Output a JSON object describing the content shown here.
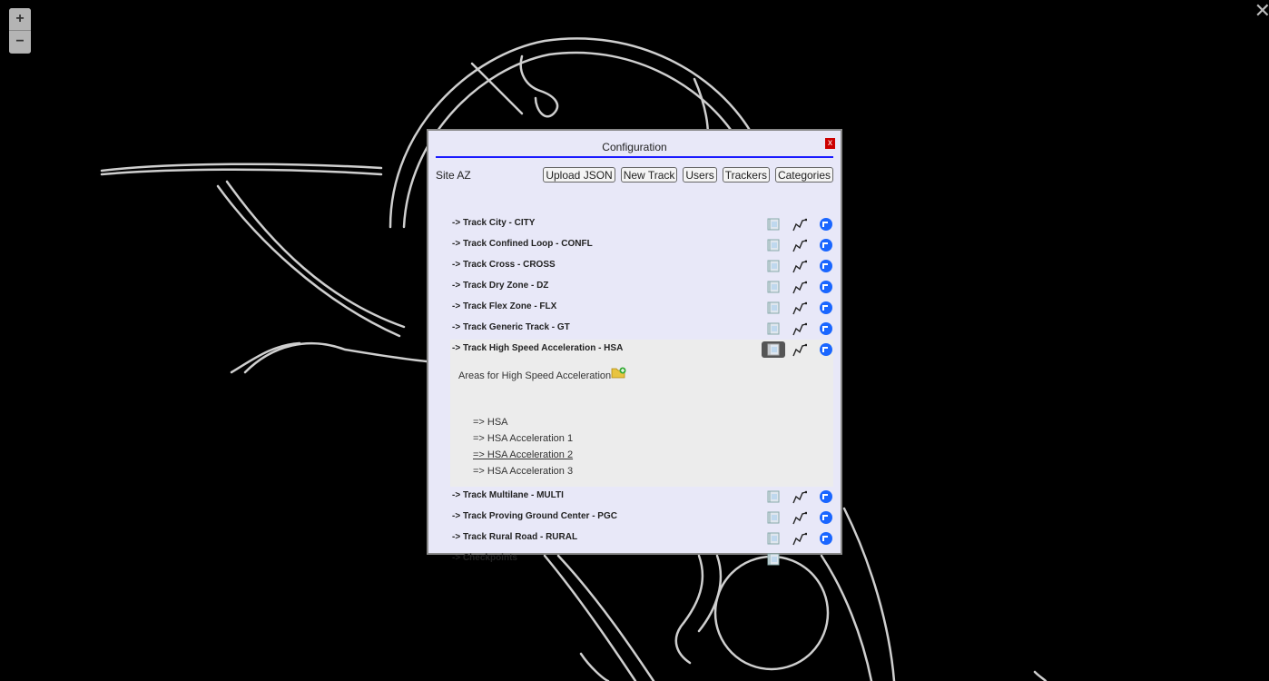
{
  "map": {
    "zoom_in": "+",
    "zoom_out": "−",
    "close": "✕"
  },
  "dialog": {
    "title": "Configuration",
    "close_label": "x",
    "site": "Site AZ",
    "buttons": [
      "Upload JSON",
      "New Track",
      "Users",
      "Trackers",
      "Categories"
    ]
  },
  "tracks": [
    {
      "label": "-> Track City - CITY"
    },
    {
      "label": "-> Track Confined Loop - CONFL"
    },
    {
      "label": "-> Track Cross - CROSS"
    },
    {
      "label": "-> Track Dry Zone - DZ"
    },
    {
      "label": "-> Track Flex Zone - FLX"
    },
    {
      "label": "-> Track Generic Track - GT"
    },
    {
      "label": "-> Track High Speed Acceleration - HSA"
    },
    {
      "label": "-> Track Multilane - MULTI"
    },
    {
      "label": "-> Track Proving Ground Center - PGC"
    },
    {
      "label": "-> Track Rural Road - RURAL"
    },
    {
      "label": "-> Checkpoints"
    }
  ],
  "expanded": {
    "title": "Areas for High Speed Acceleration",
    "areas": [
      "=> HSA",
      "=> HSA Acceleration 1",
      "=> HSA Acceleration 2",
      "=> HSA Acceleration 3"
    ]
  },
  "icons": {
    "book": "book-icon",
    "track": "track-path-icon",
    "dot": "location-icon",
    "folder": "add-folder-icon"
  },
  "colors": {
    "accent": "#1a1aff",
    "close": "#cc0000",
    "dialog_bg": "#e8e8f8",
    "dot": "#1a66ff"
  }
}
